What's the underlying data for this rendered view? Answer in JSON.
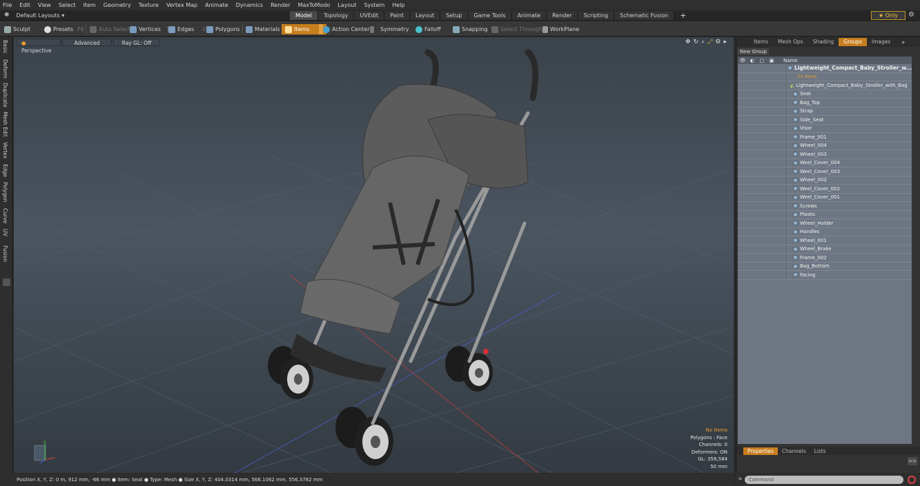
{
  "menu": [
    "File",
    "Edit",
    "View",
    "Select",
    "Item",
    "Geometry",
    "Texture",
    "Vertex Map",
    "Animate",
    "Dynamics",
    "Render",
    "MaxToModo",
    "Layout",
    "System",
    "Help"
  ],
  "layout_select": "Default Layouts ▾",
  "tabs": [
    "Model",
    "Topology",
    "UVEdit",
    "Paint",
    "Layout",
    "Setup",
    "Game Tools",
    "Animate",
    "Render",
    "Scripting",
    "Schematic Fusion"
  ],
  "active_tab": "Model",
  "only_label": "★  Only",
  "toolbar": {
    "sculpt": "Sculpt",
    "presets": "Presets",
    "presets_key": "F6",
    "auto_select": "Auto Select",
    "vertices": "Vertices",
    "vertices_key": "1",
    "edges": "Edges",
    "edges_key": "2",
    "polygons": "Polygons",
    "materials": "Materials",
    "items": "Items",
    "action_center": "Action Center",
    "symmetry": "Symmetry",
    "falloff": "Falloff",
    "snapping": "Snapping",
    "select_through": "Select Through",
    "workplane": "WorkPlane"
  },
  "left_tabs": [
    "Basic",
    "Deform",
    "Duplicate",
    "Mesh Edit",
    "Vertex",
    "Edge",
    "Polygon",
    "Curve",
    "UV",
    "Fusion"
  ],
  "viewport": {
    "perspective": "Perspective",
    "advanced": "Advanced",
    "raygl": "Ray GL: Off",
    "stats": {
      "no_items": "No Items",
      "polygons": "Polygons : Face",
      "channels": "Channels: 0",
      "deformers": "Deformers: ON",
      "gl": "GL: 358,584",
      "distance": "50 mm"
    }
  },
  "right_panel": {
    "tabs": [
      "Items",
      "Mesh Ops",
      "Shading",
      "Groups",
      "Images"
    ],
    "active_tab": "Groups",
    "new_group": "New Group",
    "name_header": "Name",
    "group_name": "Lightweight_Compact_Baby_Stroller_w...",
    "group_count": "23 Items",
    "mesh_name": "Lightweight_Compact_Baby_Stroller_with_Bag",
    "items": [
      "Seat",
      "Bag_Top",
      "Strap",
      "Side_Seat",
      "Visor",
      "Frame_001",
      "Wheel_004",
      "Wheel_003",
      "Weel_Cover_004",
      "Weel_Cover_003",
      "Wheel_002",
      "Weel_Cover_002",
      "Weel_Cover_001",
      "Screws",
      "Plastic",
      "Wheel_Holder",
      "Handles",
      "Wheel_001",
      "Wheel_Brake",
      "Frame_002",
      "Bag_Bottom",
      "Facing"
    ],
    "bottom_tabs": [
      "Properties",
      "Channels",
      "Lists"
    ],
    "bottom_active": "Properties",
    "expand": ">>"
  },
  "status": "Position X, Y, Z:  0 m, 912 mm, -66 mm ● Item:  Seat ● Type:  Mesh ● Size X, Y, Z:  404.0314 mm, 566.1062 mm, 556.3782 mm",
  "command_placeholder": "Command",
  "colors": {
    "accent": "#c77e1e",
    "list_bg": "#6d7682",
    "viewport_top": "#3b434b"
  }
}
